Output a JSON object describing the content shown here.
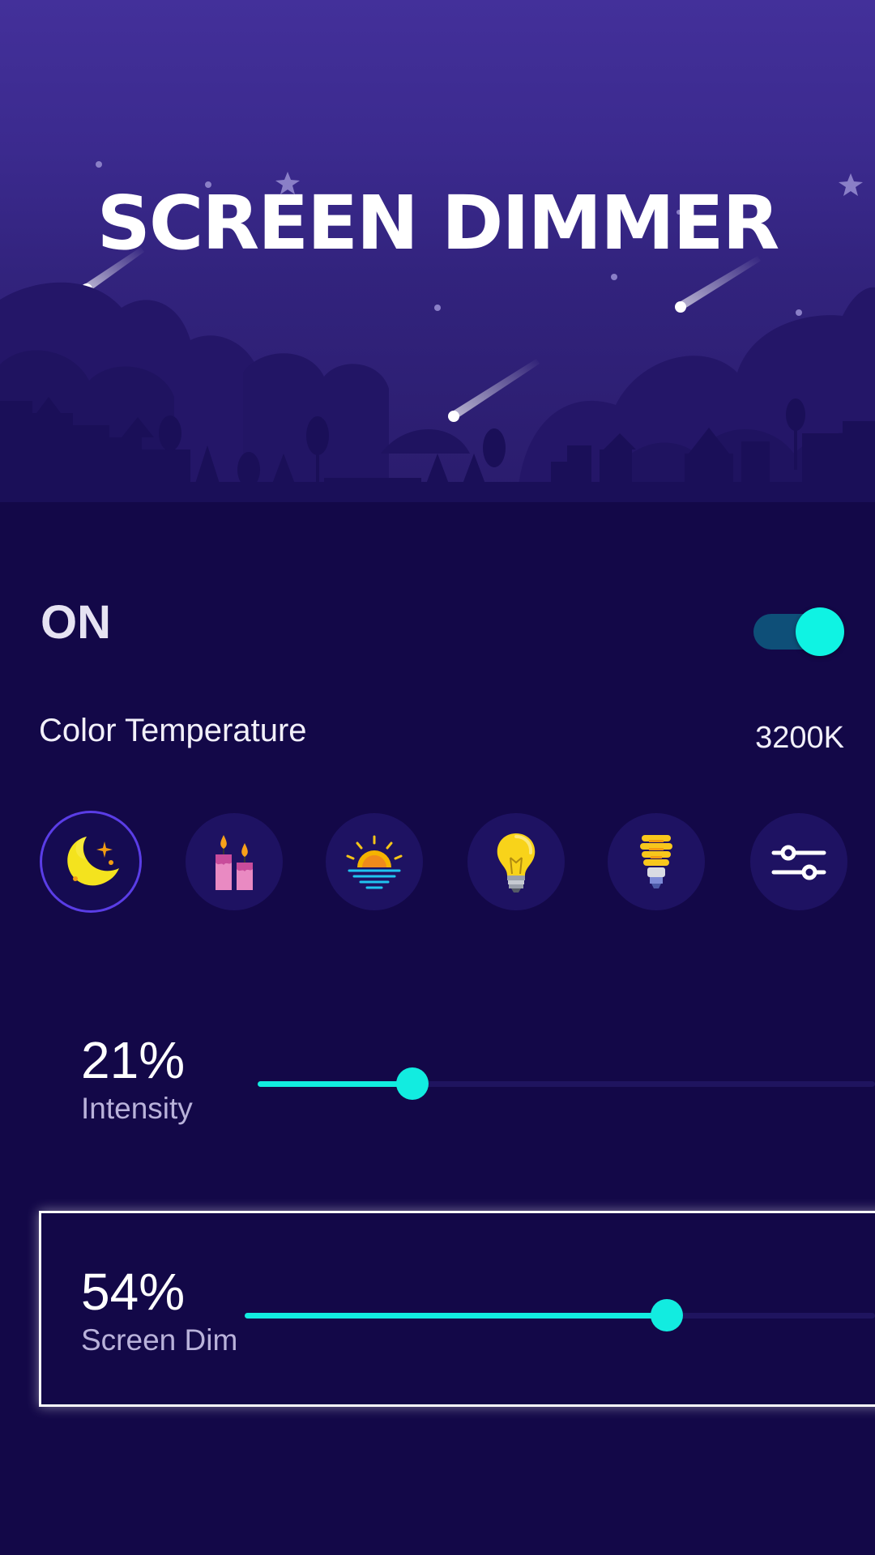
{
  "app": {
    "title": "SCREEN DIMMER"
  },
  "power": {
    "label": "ON",
    "enabled": true
  },
  "color_temperature": {
    "label": "Color Temperature",
    "value": "3200K"
  },
  "presets": {
    "selected": "moon",
    "items": [
      {
        "icon": "moon-icon"
      },
      {
        "icon": "candles-icon"
      },
      {
        "icon": "sunset-icon"
      },
      {
        "icon": "light-bulb-icon"
      },
      {
        "icon": "cfl-bulb-icon"
      },
      {
        "icon": "custom-sliders-icon"
      }
    ]
  },
  "intensity": {
    "value_text": "21%",
    "caption": "Intensity",
    "level": 0.25
  },
  "screen_dim": {
    "value_text": "54%",
    "caption": "Screen Dim",
    "level": 0.67
  },
  "colors": {
    "accent": "#12ece0",
    "background": "#130848",
    "hero_top": "#43309a",
    "toggle_track": "#0e4f78",
    "selected_ring": "#5a3de6"
  }
}
